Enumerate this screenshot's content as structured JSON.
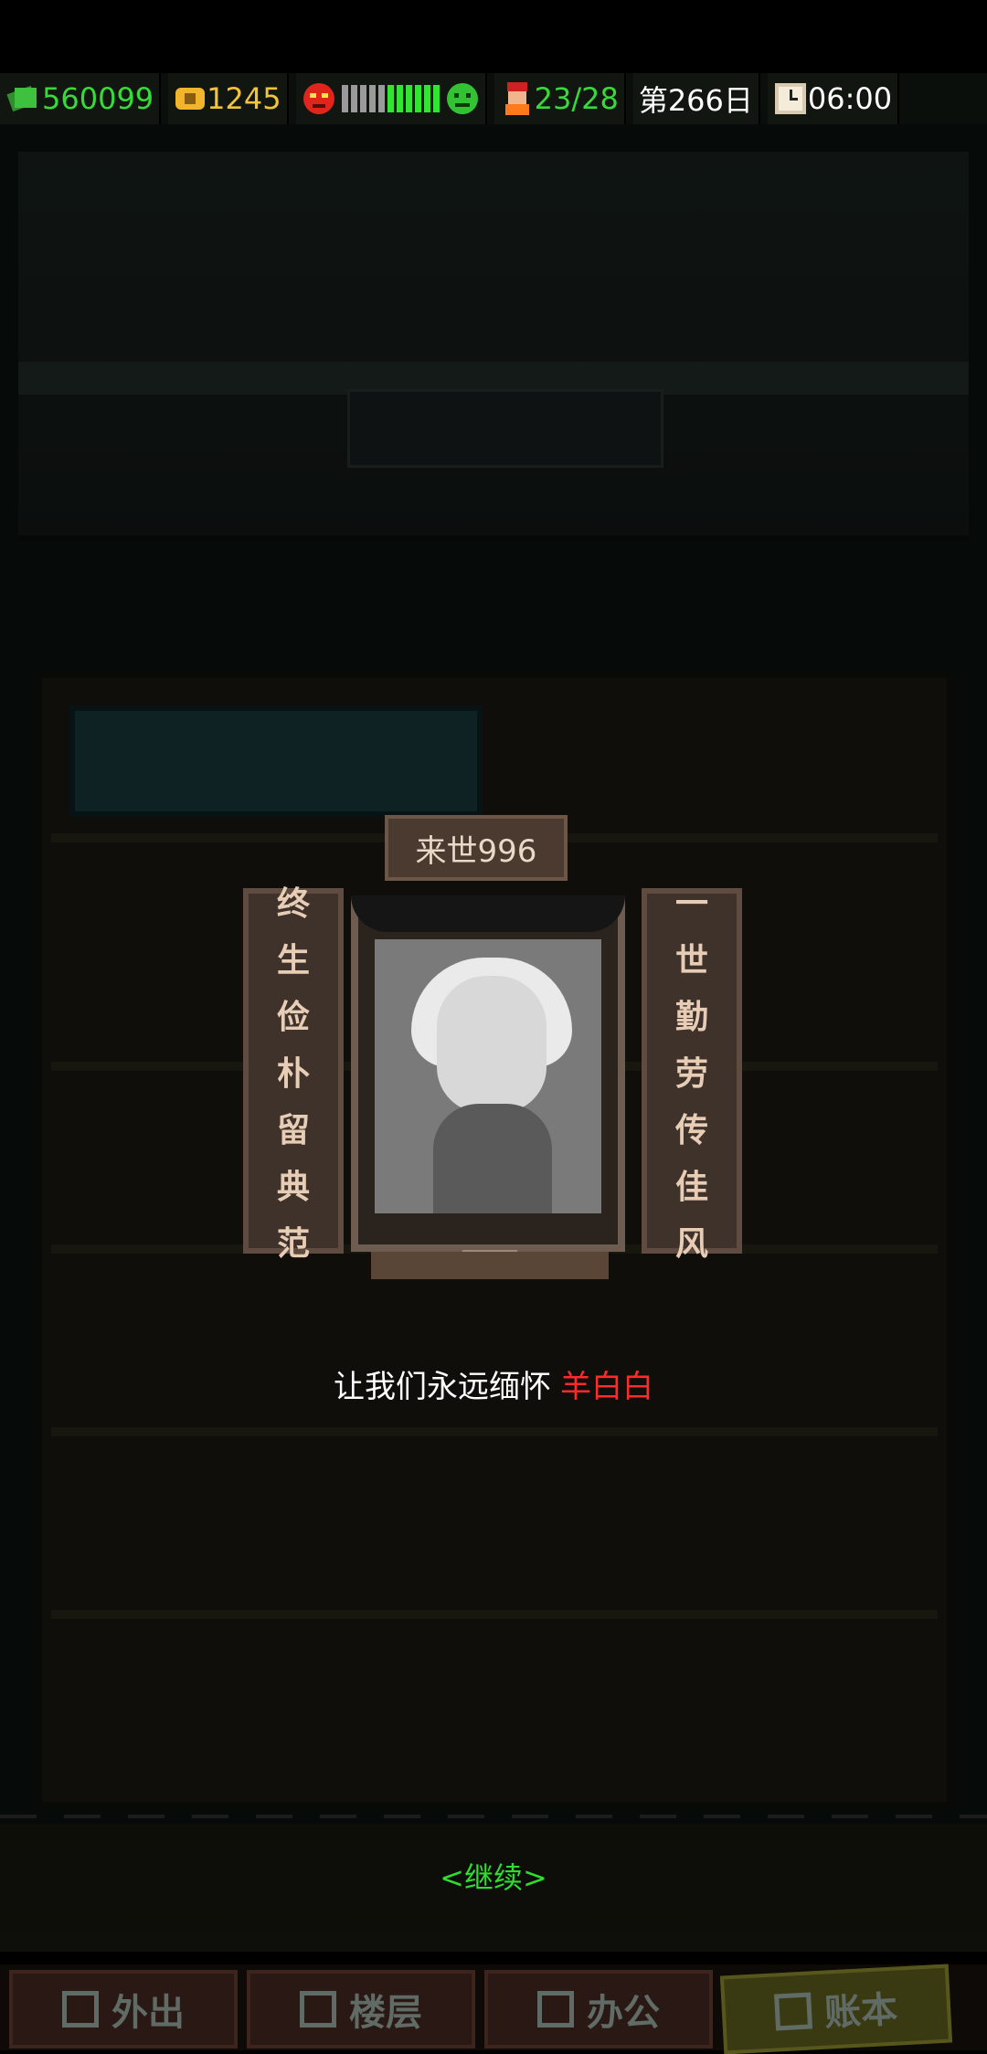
{
  "status": {
    "money": "560099",
    "coins": "1245",
    "mood_level": 0.45,
    "tenants": "23/28",
    "day": "第266日",
    "time": "06:00"
  },
  "memorial": {
    "title": "来世996",
    "left_couplet": [
      "终",
      "生",
      "俭",
      "朴",
      "留",
      "典",
      "范"
    ],
    "right_couplet": [
      "一",
      "世",
      "勤",
      "劳",
      "传",
      "佳",
      "风"
    ],
    "message": "让我们永远缅怀",
    "name": "羊白白"
  },
  "continue_label": "<继续>",
  "nav": {
    "out": "外出",
    "floors": "楼层",
    "office": "办公",
    "ledger": "账本"
  },
  "icons": {
    "money": "cash-icon",
    "coins": "coin-icon",
    "angry": "angry-face-icon",
    "happy": "happy-face-icon",
    "tenant": "tenant-avatar-icon",
    "clock": "clock-icon"
  },
  "colors": {
    "money": "#38d938",
    "coins": "#f3c43a",
    "name": "#ff2a2a",
    "continue": "#2fdc2f"
  }
}
